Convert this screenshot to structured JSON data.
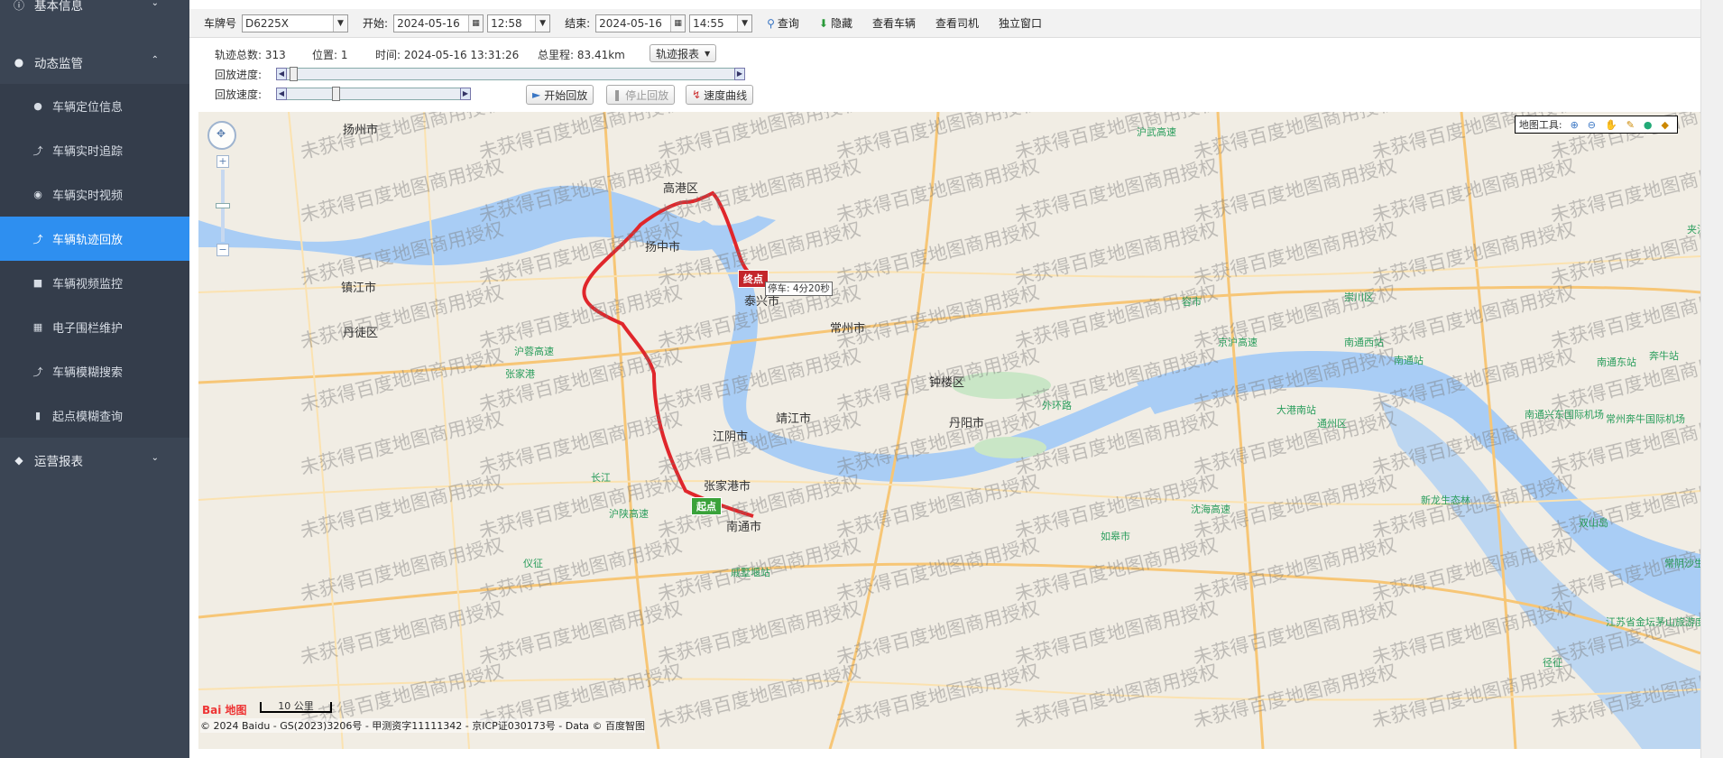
{
  "sidebar": {
    "groups": [
      {
        "label": "基本信息",
        "icon": "info-icon"
      },
      {
        "label": "动态监管",
        "icon": "location-pin-icon"
      },
      {
        "label": "运营报表",
        "icon": "tag-icon"
      }
    ],
    "items": [
      {
        "label": "车辆定位信息",
        "icon": "pin-icon"
      },
      {
        "label": "车辆实时追踪",
        "icon": "tracking-icon"
      },
      {
        "label": "车辆实时视频",
        "icon": "video-icon"
      },
      {
        "label": "车辆轨迹回放",
        "icon": "route-icon"
      },
      {
        "label": "车辆视频监控",
        "icon": "camera-icon"
      },
      {
        "label": "电子围栏维护",
        "icon": "fence-icon"
      },
      {
        "label": "车辆模糊搜索",
        "icon": "search-icon"
      },
      {
        "label": "起点模糊查询",
        "icon": "truck-icon"
      }
    ],
    "active_index": 3
  },
  "toolbar": {
    "plate_label": "车牌号",
    "plate_value": "D6225X",
    "start_label": "开始:",
    "start_date": "2024-05-16",
    "start_time": "12:58",
    "end_label": "结束:",
    "end_date": "2024-05-16",
    "end_time": "14:55",
    "query": "查询",
    "hide": "隐藏",
    "view_vehicle": "查看车辆",
    "view_driver": "查看司机",
    "standalone": "独立窗口"
  },
  "summary": {
    "track_count": "轨迹总数: 313",
    "position": "位置: 1",
    "time": "时间: 2024-05-16 13:31:26",
    "mileage": "总里程: 83.41km",
    "report_btn": "轨迹报表"
  },
  "playback": {
    "progress_label": "回放进度:",
    "speed_label": "回放速度:",
    "progress": 0.0,
    "speed": 0.25,
    "start_btn": "开始回放",
    "stop_btn": "停止回放",
    "curve_btn": "速度曲线"
  },
  "map": {
    "tools_label": "地图工具:",
    "end_marker": "终点",
    "start_marker": "起点",
    "stop_info": "停车: 4分20秒",
    "scale": "10 公里",
    "copyright": "© 2024 Baidu - GS(2023)3206号 - 甲测资字11111342 - 京ICP证030173号 - Data © 百度智图",
    "watermark": "未获得百度地图商用授权",
    "route_color": "#e0262b",
    "cities": [
      "扬州市",
      "高港区",
      "扬中市",
      "镇江市",
      "丹徒区",
      "泰兴市",
      "靖江市",
      "江阴市",
      "张家港市",
      "南通市",
      "常州市",
      "钟楼区",
      "丹阳市",
      "如皋市",
      "通州区",
      "崇川区",
      "南通西站",
      "南通站",
      "南通东站",
      "南通兴东国际机场",
      "常州奔牛国际机场",
      "奔牛站",
      "大港南站",
      "张家港",
      "长江",
      "沪陕高速",
      "沪蓉高速",
      "京沪高速",
      "沈海高速",
      "沪武高速",
      "外环路",
      "新龙生态林",
      "双山岛",
      "常阴沙生态农业旅游区",
      "江苏省金坛茅山旅游度假区",
      "戚墅堰站",
      "仪征",
      "径征",
      "容市",
      "夹江"
    ],
    "logo": "Bai 地图"
  }
}
